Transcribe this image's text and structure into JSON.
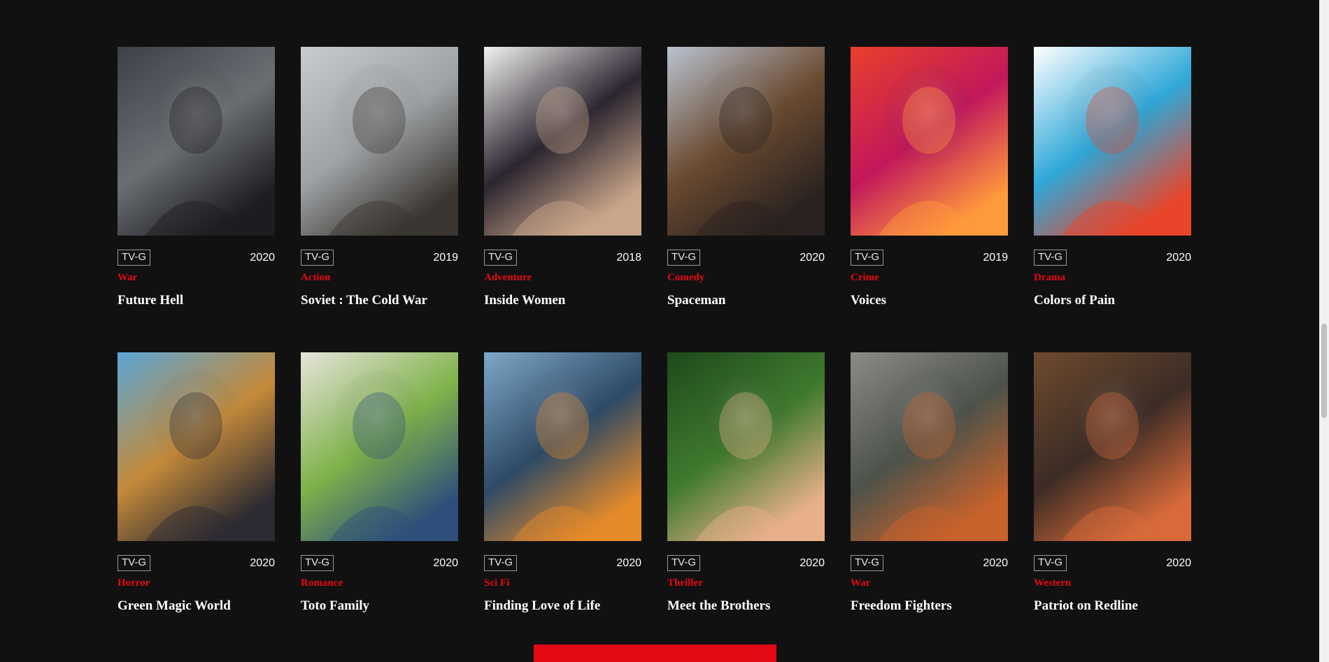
{
  "movies": [
    {
      "rating": "TV-G",
      "year": "2020",
      "genre": "War",
      "title": "Future Hell",
      "palette": [
        "#3d4047",
        "#6b6e73",
        "#1c1d21"
      ]
    },
    {
      "rating": "TV-G",
      "year": "2019",
      "genre": "Action",
      "title": "Soviet : The Cold War",
      "palette": [
        "#c9cccd",
        "#9ea2a5",
        "#3a3530"
      ]
    },
    {
      "rating": "TV-G",
      "year": "2018",
      "genre": "Adventure",
      "title": "Inside Women",
      "palette": [
        "#f2f1ef",
        "#2b2530",
        "#c9a68a"
      ]
    },
    {
      "rating": "TV-G",
      "year": "2020",
      "genre": "Comedy",
      "title": "Spaceman",
      "palette": [
        "#b9c3d1",
        "#6a4a30",
        "#2a2220"
      ]
    },
    {
      "rating": "TV-G",
      "year": "2019",
      "genre": "Crime",
      "title": "Voices",
      "palette": [
        "#e8402a",
        "#c2185b",
        "#ff9a3c"
      ]
    },
    {
      "rating": "TV-G",
      "year": "2020",
      "genre": "Drama",
      "title": "Colors of Pain",
      "palette": [
        "#ffffff",
        "#2fa8d8",
        "#e8452a"
      ]
    },
    {
      "rating": "TV-G",
      "year": "2020",
      "genre": "Horror",
      "title": "Green Magic World",
      "palette": [
        "#5aa6d6",
        "#c48a3a",
        "#2c2a32"
      ]
    },
    {
      "rating": "TV-G",
      "year": "2020",
      "genre": "Romance",
      "title": "Toto Family",
      "palette": [
        "#e6e4dc",
        "#7fb24a",
        "#2f4f7a"
      ]
    },
    {
      "rating": "TV-G",
      "year": "2020",
      "genre": "Sci Fi",
      "title": "Finding Love of Life",
      "palette": [
        "#7fa7c8",
        "#2d4a66",
        "#e58a2a"
      ]
    },
    {
      "rating": "TV-G",
      "year": "2020",
      "genre": "Thriller",
      "title": "Meet the Brothers",
      "palette": [
        "#1e4a1c",
        "#3f7a2e",
        "#e8b08a"
      ]
    },
    {
      "rating": "TV-G",
      "year": "2020",
      "genre": "War",
      "title": "Freedom Fighters",
      "palette": [
        "#8a8c86",
        "#4d524a",
        "#c9622a"
      ]
    },
    {
      "rating": "TV-G",
      "year": "2020",
      "genre": "Western",
      "title": "Patriot on Redline",
      "palette": [
        "#6e4a2e",
        "#3c2c25",
        "#d86a3a"
      ]
    }
  ],
  "load_more": {
    "label": ""
  },
  "colors": {
    "accent": "#e50914",
    "background": "#111111"
  }
}
